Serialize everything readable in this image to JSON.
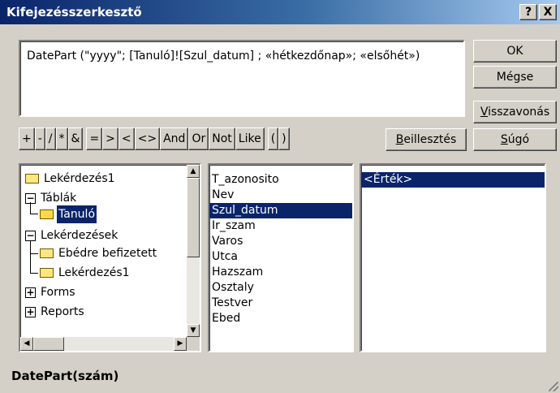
{
  "window": {
    "title": "Kifejezésszerkesztő",
    "help_label": "?",
    "close_label": "X"
  },
  "expression": "DatePart (\"yyyy\"; [Tanuló]![Szul_datum] ; «hétkezdőnap»; «elsőhét»)",
  "buttons": {
    "ok": "OK",
    "cancel": "Mégse",
    "undo_key": "V",
    "undo_rest": "isszavonás",
    "paste_key": "B",
    "paste_rest": "eillesztés",
    "help_key": "S",
    "help_rest": "úgó"
  },
  "operators": [
    "+",
    "-",
    "/",
    "*",
    "&",
    "=",
    ">",
    "<",
    "<>",
    "And",
    "Or",
    "Not",
    "Like",
    "(",
    ")"
  ],
  "tree": {
    "items": [
      {
        "label": "Lekérdezés1"
      },
      {
        "label": "Táblák"
      },
      {
        "label": "Tanuló"
      },
      {
        "label": "Lekérdezések"
      },
      {
        "label": "Ebédre befizetett"
      },
      {
        "label": "Lekérdezés1"
      },
      {
        "label": "Forms"
      },
      {
        "label": "Reports"
      }
    ]
  },
  "fields": [
    "T_azonosito",
    "Nev",
    "Szul_datum",
    "Ir_szam",
    "Varos",
    "Utca",
    "Hazszam",
    "Osztaly",
    "Testver",
    "Ebed"
  ],
  "selected_field": "Szul_datum",
  "values": [
    "<Érték>"
  ],
  "status_text": "DatePart(szám)"
}
